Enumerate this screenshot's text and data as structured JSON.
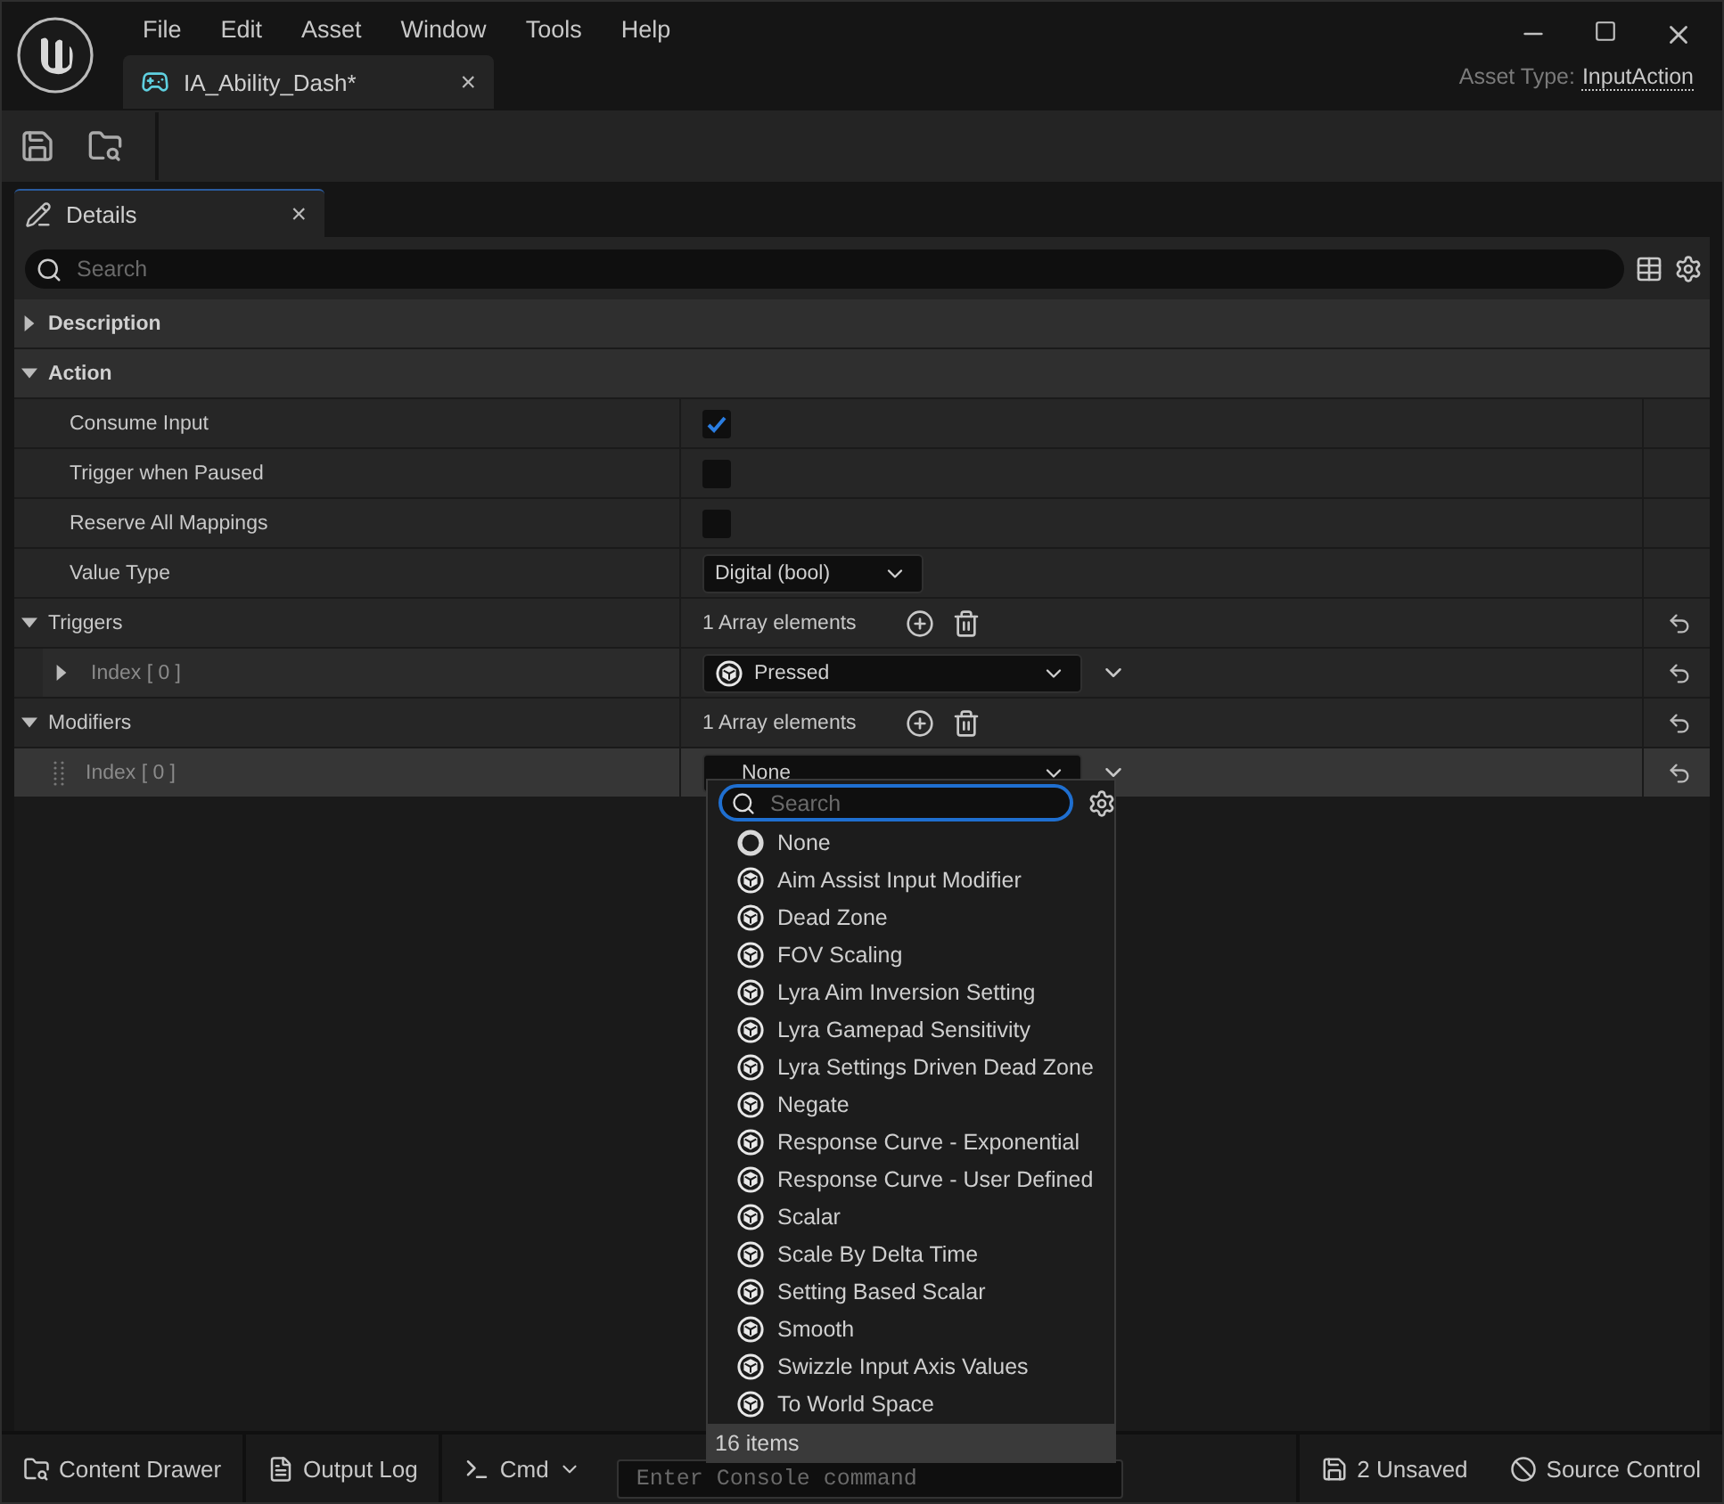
{
  "menu": [
    "File",
    "Edit",
    "Asset",
    "Window",
    "Tools",
    "Help"
  ],
  "document_tab": {
    "title": "IA_Ability_Dash*",
    "close": "×"
  },
  "asset_type": {
    "label": "Asset Type:",
    "value": "InputAction"
  },
  "panel_tab": {
    "title": "Details",
    "close": "×"
  },
  "search": {
    "placeholder": "Search"
  },
  "rows": [
    {
      "kind": "category",
      "label": "Description",
      "expanded": false
    },
    {
      "kind": "category",
      "label": "Action",
      "expanded": true
    },
    {
      "kind": "checkbox",
      "label": "Consume Input",
      "checked": true
    },
    {
      "kind": "checkbox",
      "label": "Trigger when Paused",
      "checked": false
    },
    {
      "kind": "checkbox",
      "label": "Reserve All Mappings",
      "checked": false
    },
    {
      "kind": "combo",
      "label": "Value Type",
      "value": "Digital (bool)"
    },
    {
      "kind": "array",
      "label": "Triggers",
      "expanded": true,
      "count": "1 Array elements"
    },
    {
      "kind": "item",
      "label": "Index [ 0 ]",
      "expandable": true,
      "selected": false,
      "value": "Pressed",
      "has_icon": true
    },
    {
      "kind": "array",
      "label": "Modifiers",
      "expanded": true,
      "count": "1 Array elements"
    },
    {
      "kind": "item",
      "label": "Index [ 0 ]",
      "expandable": false,
      "selected": true,
      "value": "None",
      "has_icon": false
    }
  ],
  "dropdown": {
    "search_placeholder": "Search",
    "options": [
      {
        "label": "None",
        "kind": "none"
      },
      {
        "label": "Aim Assist Input Modifier",
        "kind": "class"
      },
      {
        "label": "Dead Zone",
        "kind": "class"
      },
      {
        "label": "FOV Scaling",
        "kind": "class"
      },
      {
        "label": "Lyra Aim Inversion Setting",
        "kind": "class"
      },
      {
        "label": "Lyra Gamepad Sensitivity",
        "kind": "class"
      },
      {
        "label": "Lyra Settings Driven Dead Zone",
        "kind": "class"
      },
      {
        "label": "Negate",
        "kind": "class"
      },
      {
        "label": "Response Curve - Exponential",
        "kind": "class"
      },
      {
        "label": "Response Curve - User Defined",
        "kind": "class"
      },
      {
        "label": "Scalar",
        "kind": "class"
      },
      {
        "label": "Scale By Delta Time",
        "kind": "class"
      },
      {
        "label": "Setting Based Scalar",
        "kind": "class"
      },
      {
        "label": "Smooth",
        "kind": "class"
      },
      {
        "label": "Swizzle Input Axis Values",
        "kind": "class"
      },
      {
        "label": "To World Space",
        "kind": "class"
      }
    ],
    "footer": "16 items"
  },
  "status_bar": {
    "content_drawer": "Content Drawer",
    "output_log": "Output Log",
    "cmd": "Cmd",
    "console_placeholder": "Enter Console command",
    "unsaved": "2 Unsaved",
    "source_control": "Source Control"
  }
}
